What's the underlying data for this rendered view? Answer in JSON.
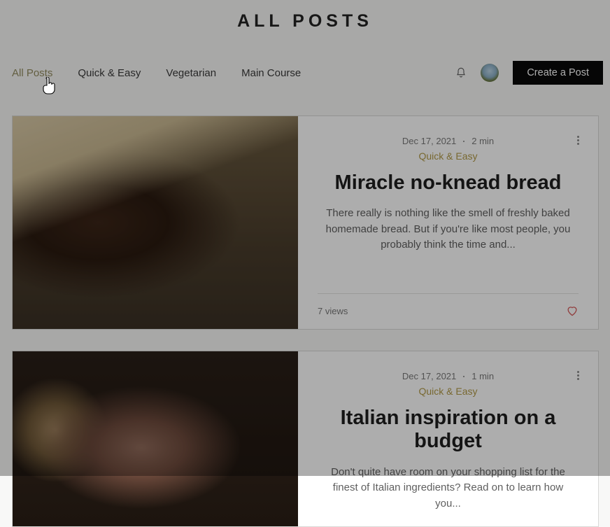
{
  "page_title": "ALL POSTS",
  "nav": {
    "tabs": [
      "All Posts",
      "Quick & Easy",
      "Vegetarian",
      "Main Course"
    ],
    "active_index": 0,
    "create_label": "Create a Post"
  },
  "posts": [
    {
      "date": "Dec 17, 2021",
      "read_time": "2 min",
      "category": "Quick & Easy",
      "title": "Miracle no-knead bread",
      "excerpt": "There really is nothing like the smell of freshly baked homemade bread. But if you're like most people, you probably think the time and...",
      "views": "7 views"
    },
    {
      "date": "Dec 17, 2021",
      "read_time": "1 min",
      "category": "Quick & Easy",
      "title": "Italian inspiration on a budget",
      "excerpt": "Don't quite have room on your shopping list for the finest of Italian ingredients? Read on to learn how you..."
    }
  ]
}
